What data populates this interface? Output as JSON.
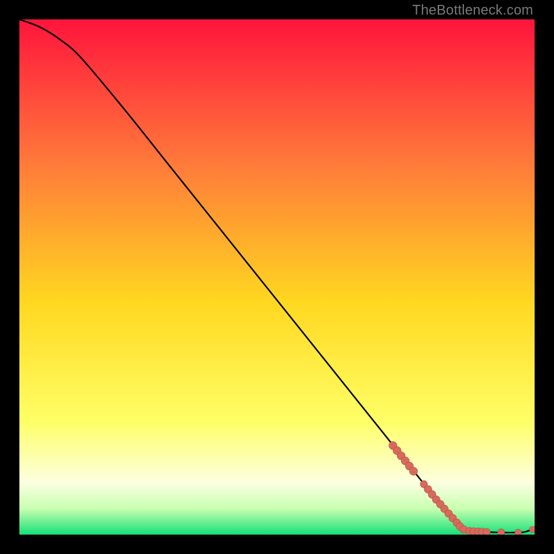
{
  "watermark": "TheBottleneck.com",
  "colors": {
    "gradient_top": "#ff143c",
    "gradient_mid_upper": "#ff7a3a",
    "gradient_mid": "#ffd820",
    "gradient_mid_lower": "#ffff66",
    "gradient_low1": "#fbffe0",
    "gradient_low2": "#c8ffb0",
    "gradient_bottom": "#14e078",
    "curve": "#000000",
    "marker_fill": "#d86a5c",
    "marker_stroke": "#b84a42"
  },
  "chart_data": {
    "type": "line",
    "title": "",
    "xlabel": "",
    "ylabel": "",
    "xlim": [
      0,
      100
    ],
    "ylim": [
      0,
      100
    ],
    "series": [
      {
        "name": "bottleneck-curve",
        "x": [
          0,
          4,
          8,
          12,
          20,
          30,
          40,
          50,
          60,
          70,
          78,
          82,
          85,
          86,
          88,
          90,
          92,
          94,
          96,
          98,
          100
        ],
        "y": [
          100,
          98.5,
          96,
          92.5,
          83,
          70.5,
          58,
          45.5,
          33,
          20.5,
          10.5,
          5.5,
          1.8,
          0.8,
          0.6,
          0.5,
          0.45,
          0.4,
          0.4,
          0.5,
          1.2
        ]
      }
    ],
    "markers": [
      {
        "x": 72.5,
        "y": 17.3,
        "r": 5.8
      },
      {
        "x": 73.3,
        "y": 16.3,
        "r": 5.8
      },
      {
        "x": 74.1,
        "y": 15.3,
        "r": 5.8
      },
      {
        "x": 74.9,
        "y": 14.3,
        "r": 5.8
      },
      {
        "x": 75.7,
        "y": 13.3,
        "r": 5.8
      },
      {
        "x": 76.5,
        "y": 12.3,
        "r": 5.8
      },
      {
        "x": 78.5,
        "y": 9.8,
        "r": 5.2
      },
      {
        "x": 79.3,
        "y": 8.8,
        "r": 5.5
      },
      {
        "x": 80.1,
        "y": 7.8,
        "r": 5.5
      },
      {
        "x": 80.9,
        "y": 6.8,
        "r": 5.5
      },
      {
        "x": 81.7,
        "y": 5.9,
        "r": 5.5
      },
      {
        "x": 82.5,
        "y": 5.0,
        "r": 5.5
      },
      {
        "x": 83.3,
        "y": 4.1,
        "r": 5.5
      },
      {
        "x": 84.1,
        "y": 3.2,
        "r": 5.5
      },
      {
        "x": 84.9,
        "y": 2.3,
        "r": 5.5
      },
      {
        "x": 85.5,
        "y": 1.6,
        "r": 5.5
      },
      {
        "x": 86.2,
        "y": 1.0,
        "r": 5.5
      },
      {
        "x": 87.3,
        "y": 0.7,
        "r": 5.2
      },
      {
        "x": 88.1,
        "y": 0.65,
        "r": 5.2
      },
      {
        "x": 89.0,
        "y": 0.6,
        "r": 5.2
      },
      {
        "x": 89.8,
        "y": 0.55,
        "r": 5.2
      },
      {
        "x": 90.7,
        "y": 0.5,
        "r": 5.2
      },
      {
        "x": 93.5,
        "y": 0.45,
        "r": 5.0
      },
      {
        "x": 96.8,
        "y": 0.4,
        "r": 4.8
      },
      {
        "x": 99.6,
        "y": 1.0,
        "r": 4.5
      }
    ]
  }
}
